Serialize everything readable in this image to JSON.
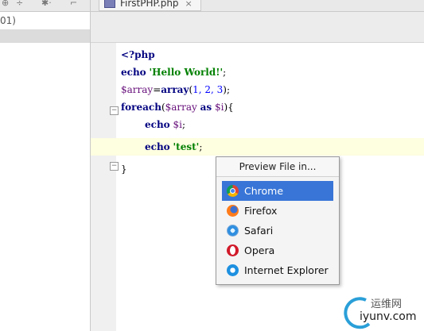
{
  "left_panel": {
    "toolbar_glyphs": [
      "⊕",
      "÷",
      "✱·",
      "⌐"
    ],
    "tree_row_text": "01)"
  },
  "tab": {
    "label": "FirstPHP.php",
    "close": "×"
  },
  "code": {
    "line1": "<?php",
    "line2_kw": "echo",
    "line2_str": "'Hello World!'",
    "line2_end": ";",
    "line3_var": "$array",
    "line3_eq": "=",
    "line3_fn": "array",
    "line3_args_open": "(",
    "line3_args": "1, 2, 3",
    "line3_end": ");",
    "line4_kw": "foreach",
    "line4_open": "(",
    "line4_var1": "$array",
    "line4_as": "as",
    "line4_var2": "$i",
    "line4_close": "){",
    "line5_kw": "echo",
    "line5_var": "$i",
    "line5_end": ";",
    "line6_kw": "echo",
    "line6_str": "'test'",
    "line6_end": ";",
    "line7": "}"
  },
  "popup": {
    "title": "Preview File in...",
    "items": [
      {
        "label": "Chrome",
        "icon": "chrome-icon",
        "selected": true
      },
      {
        "label": "Firefox",
        "icon": "firefox-icon",
        "selected": false
      },
      {
        "label": "Safari",
        "icon": "safari-icon",
        "selected": false
      },
      {
        "label": "Opera",
        "icon": "opera-icon",
        "selected": false
      },
      {
        "label": "Internet Explorer",
        "icon": "ie-icon",
        "selected": false
      }
    ]
  },
  "watermark": {
    "line1": "运维网",
    "line2": "iyunv.com"
  },
  "colors": {
    "selection": "#3875d7",
    "current_line": "#fefee0",
    "keyword": "#000080",
    "string": "#008000"
  }
}
